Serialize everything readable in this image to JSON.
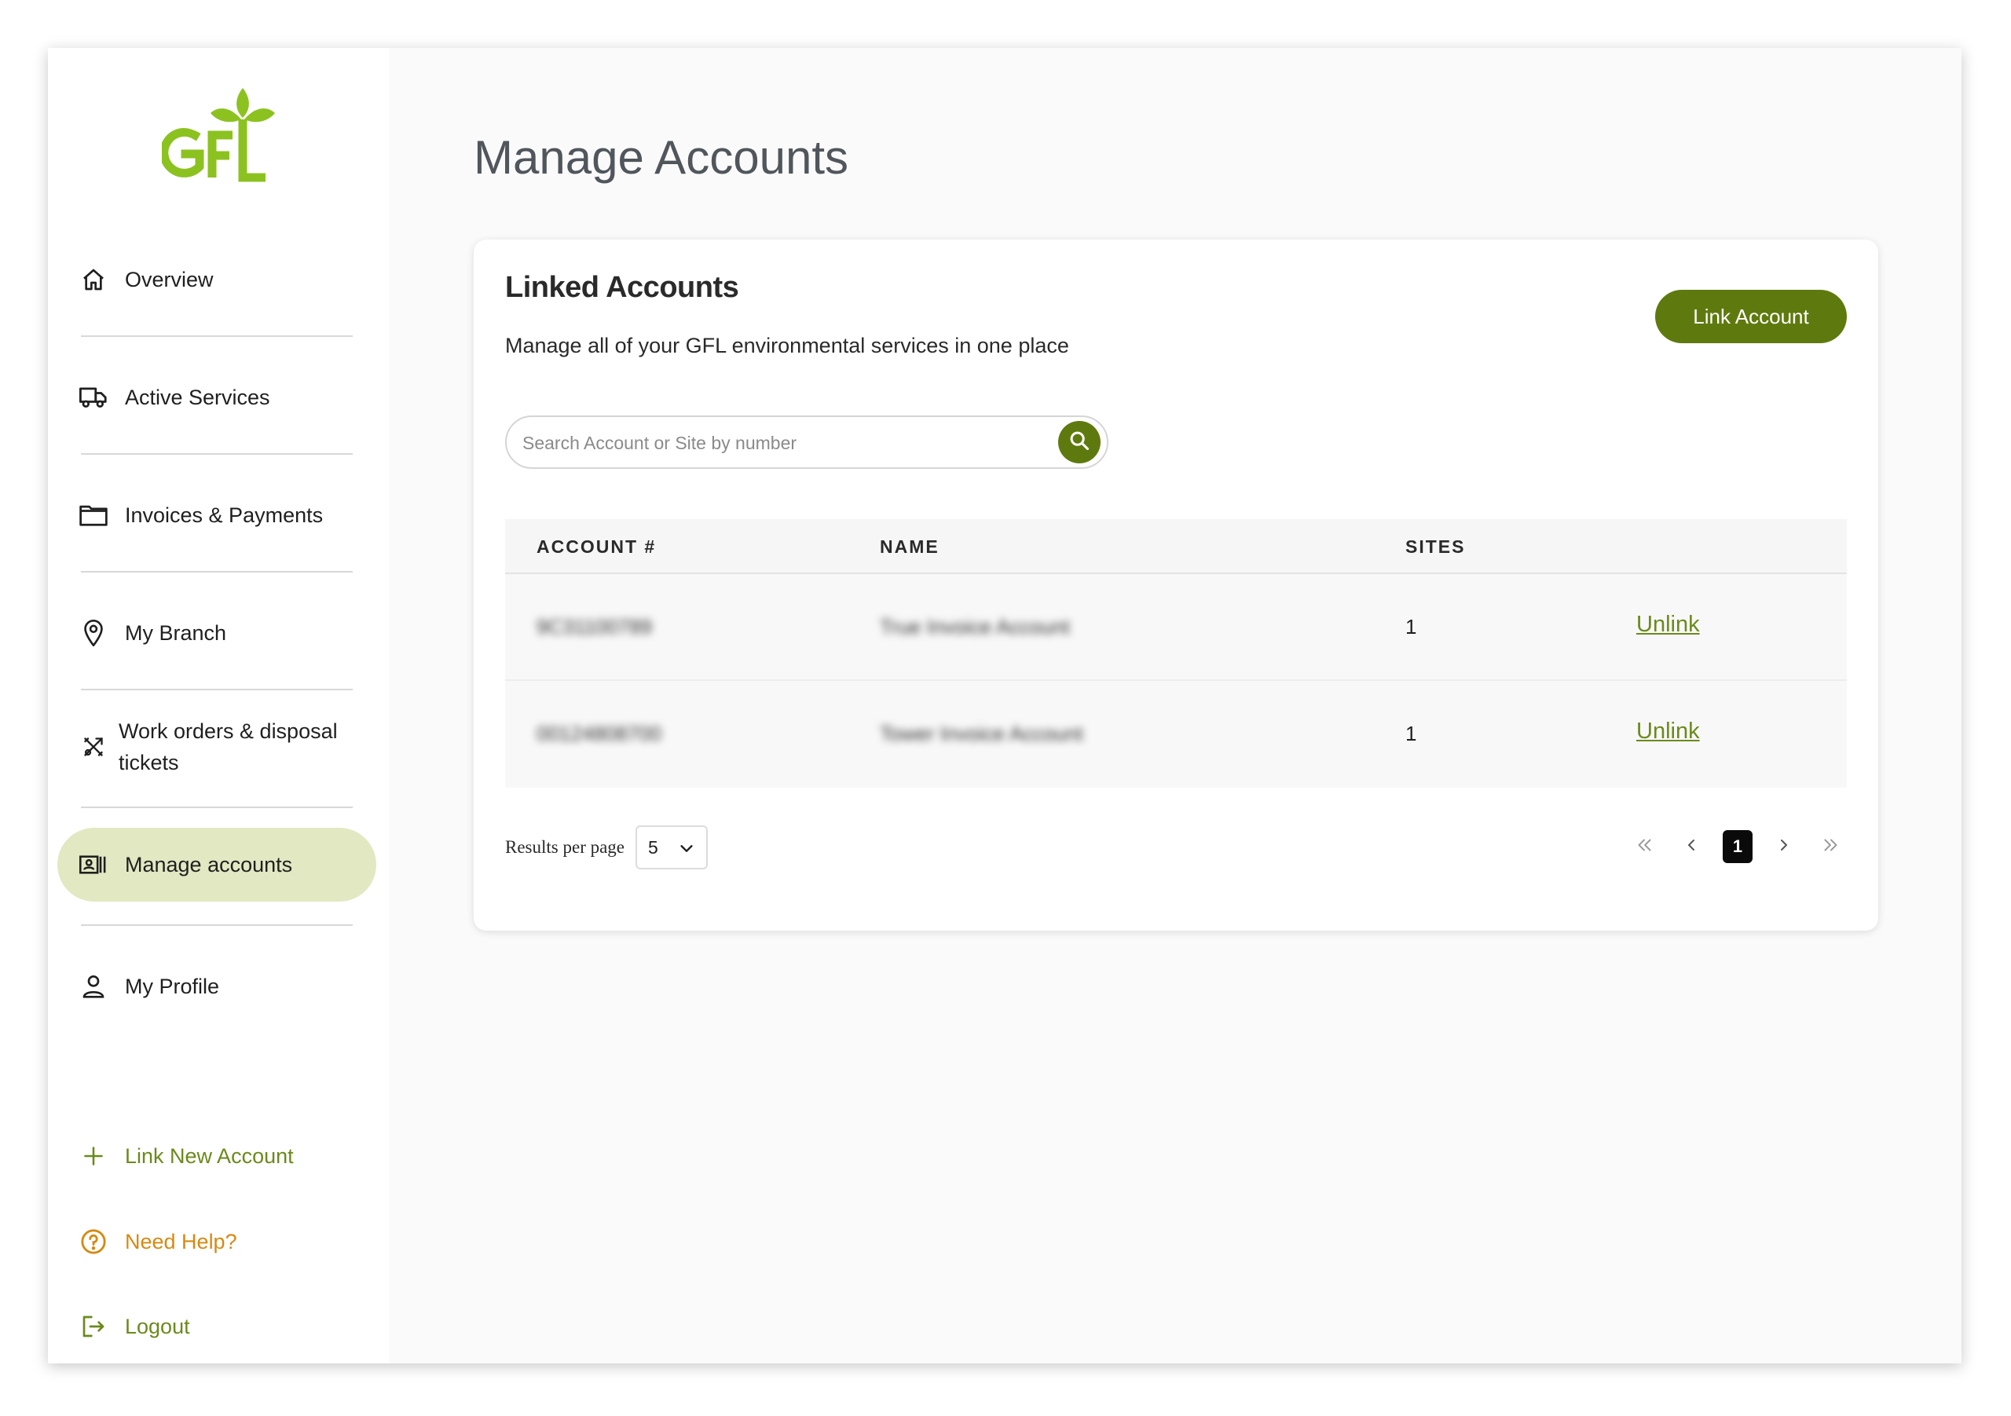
{
  "brand": {
    "logo_text": "GFL",
    "logo_color": "#8cc220"
  },
  "sidebar": {
    "items": [
      {
        "label": "Overview",
        "icon": "home-icon"
      },
      {
        "label": "Active Services",
        "icon": "truck-icon"
      },
      {
        "label": "Invoices & Payments",
        "icon": "folder-icon"
      },
      {
        "label": "My Branch",
        "icon": "location-pin-icon"
      },
      {
        "label": "Work orders & disposal tickets",
        "icon": "tools-icon"
      },
      {
        "label": "Manage accounts",
        "icon": "account-card-icon",
        "active": true
      },
      {
        "label": "My Profile",
        "icon": "user-icon"
      }
    ],
    "bottom_links": [
      {
        "label": "Link New Account",
        "icon": "plus-icon"
      },
      {
        "label": "Need Help?",
        "icon": "help-circle-icon"
      },
      {
        "label": "Logout",
        "icon": "logout-icon"
      }
    ]
  },
  "page": {
    "title": "Manage Accounts"
  },
  "card": {
    "title": "Linked Accounts",
    "subtitle": "Manage all of your GFL environmental services in one place",
    "link_button": "Link Account",
    "search": {
      "placeholder": "Search Account or Site by number",
      "value": ""
    },
    "table": {
      "columns": [
        "ACCOUNT #",
        "NAME",
        "SITES",
        ""
      ],
      "rows": [
        {
          "account": "9C31100789",
          "name": "True Invoice Account",
          "sites": "1",
          "action": "Unlink"
        },
        {
          "account": "00124808700",
          "name": "Tower Invoice Account",
          "sites": "1",
          "action": "Unlink"
        }
      ]
    },
    "pagination": {
      "results_label": "Results per page",
      "results_value": "5",
      "current_page": "1"
    }
  },
  "colors": {
    "accent": "#5e7a0e",
    "active_bg": "#e2e8c2",
    "link_green": "#6a8a1b",
    "help_orange": "#d68a12"
  }
}
